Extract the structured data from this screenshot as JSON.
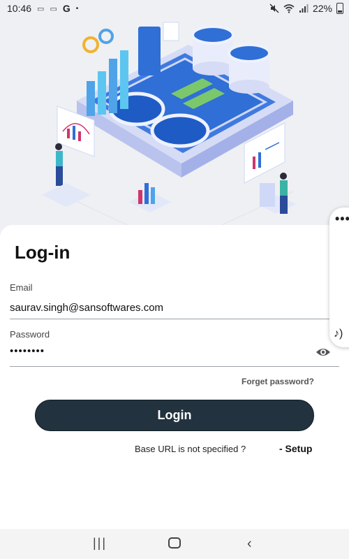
{
  "status_bar": {
    "time": "10:46",
    "notification_icons": [
      "sim-icon",
      "sim-icon",
      "google-icon",
      "dot-icon"
    ],
    "google_glyph": "G",
    "dot_glyph": "•",
    "battery_text": "22%",
    "right_icons": [
      "mute-icon",
      "wifi-icon",
      "signal-icon",
      "battery-icon"
    ]
  },
  "login": {
    "title": "Log-in",
    "email_label": "Email",
    "email_value": "saurav.singh@sansoftwares.com",
    "password_label": "Password",
    "password_value": "••••••••",
    "forgot_label": "Forget password?",
    "login_label": "Login",
    "base_url_text": "Base URL is not specified ?",
    "setup_label": "- Setup"
  },
  "side_panel": {
    "menu_glyph": "•••",
    "audio_glyph": "♪)"
  },
  "nav_bar": {
    "recent_glyph": "|||",
    "back_glyph": "‹"
  },
  "colors": {
    "accent_dark": "#22333f",
    "hero_bg": "#eef0f3",
    "water_blue": "#2f6fd6"
  }
}
